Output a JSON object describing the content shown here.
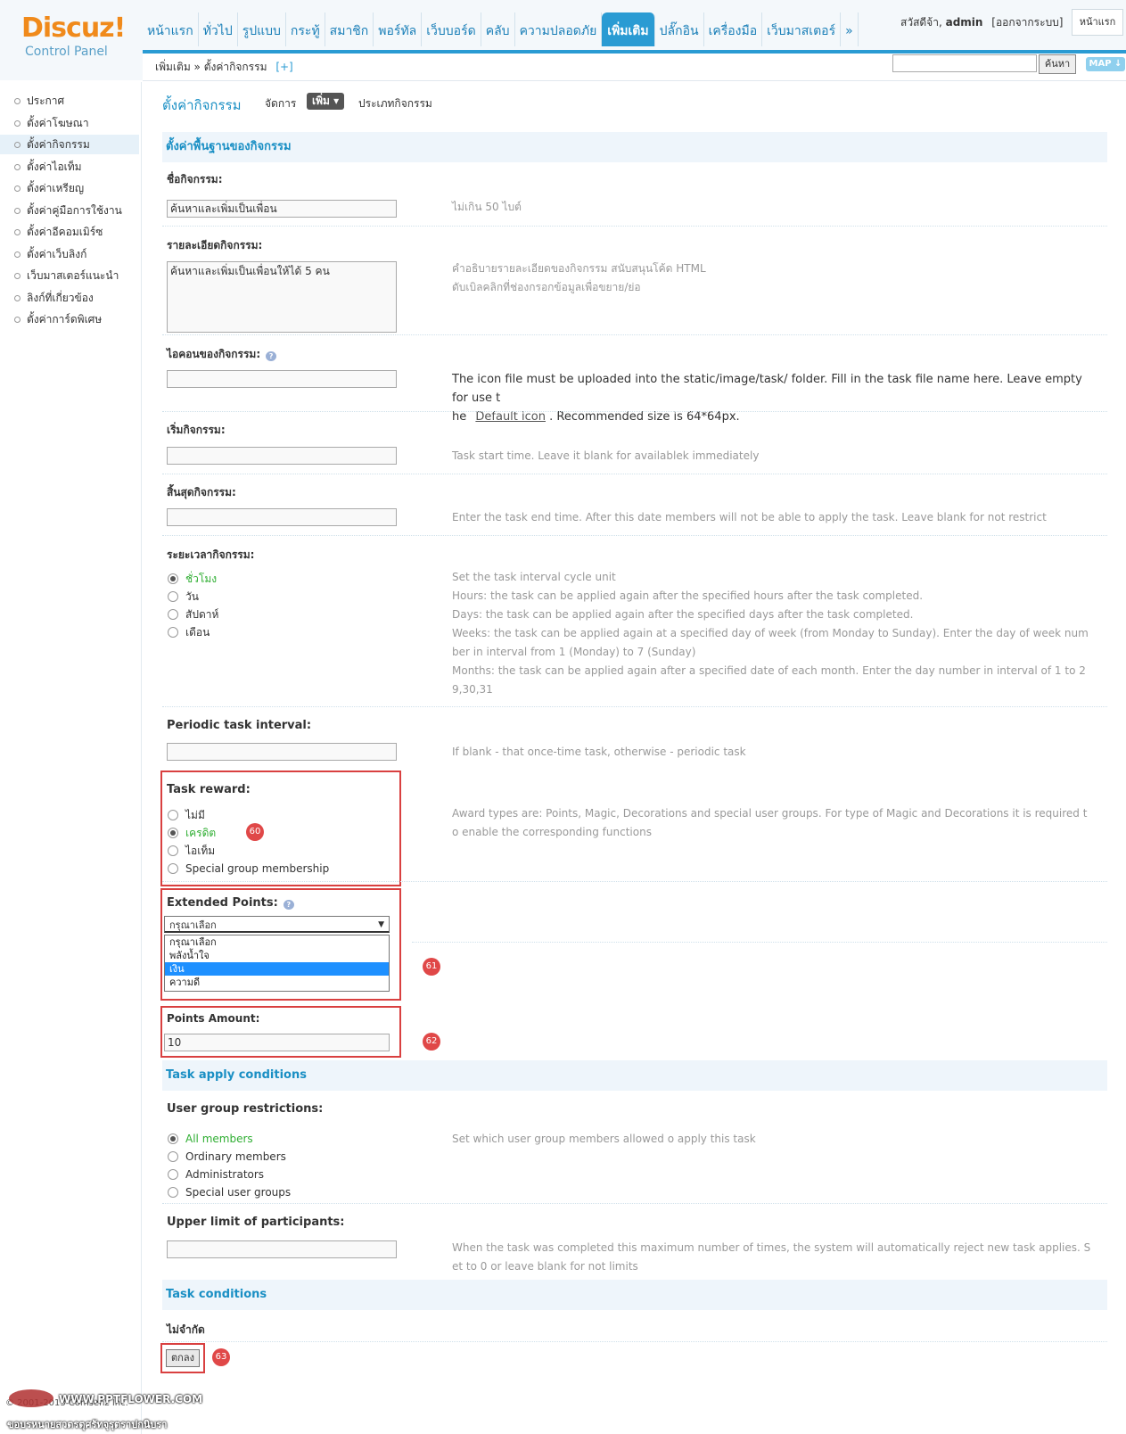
{
  "app": {
    "logo_main": "Discuz!",
    "logo_sub": "Control Panel"
  },
  "nav": [
    "หน้าแรก",
    "ทั่วไป",
    "รูปแบบ",
    "กระทู้",
    "สมาชิก",
    "พอร์ทัล",
    "เว็บบอร์ด",
    "คลับ",
    "ความปลอดภัย",
    "เพิ่มเติม",
    "ปลั๊กอิน",
    "เครื่องมือ",
    "เว็บมาสเตอร์",
    "»"
  ],
  "user": {
    "greeting": "สวัสดีจ้า,",
    "name": "admin",
    "logout": "[ออกจากระบบ]",
    "home": "หน้าแรก"
  },
  "breadcrumb": {
    "path": "เพิ่มเติม » ตั้งค่ากิจกรรม",
    "plus": "[+]"
  },
  "search": {
    "button": "ค้นหา",
    "map": "MAP ↓"
  },
  "sidebar": [
    "ประกาศ",
    "ตั้งค่าโฆษณา",
    "ตั้งค่ากิจกรรม",
    "ตั้งค่าไอเท็ม",
    "ตั้งค่าเหรียญ",
    "ตั้งค่าคู่มือการใช้งาน",
    "ตั้งค่าอีคอมเมิร์ซ",
    "ตั้งค่าเว็บลิงก์",
    "เว็บมาสเตอร์แนะนำ",
    "ลิงก์ที่เกี่ยวข้อง",
    "ตั้งค่าการ์ดพิเศษ"
  ],
  "page": {
    "title": "ตั้งค่ากิจกรรม",
    "tab_manage": "จัดการ",
    "tab_add": "เพิ่ม ▾",
    "tab_types": "ประเภทกิจกรรม"
  },
  "section_basic": "ตั้งค่าพื้นฐานของกิจกรรม",
  "fields": {
    "name": {
      "label": "ชื่อกิจกรรม:",
      "value": "ค้นหาและเพิ่มเป็นเพื่อน",
      "tip": "ไม่เกิน 50 ไบต์"
    },
    "desc": {
      "label": "รายละเอียดกิจกรรม:",
      "value": "ค้นหาและเพิ่มเป็นเพื่อนให้ได้ 5 คน",
      "tip1": "คำอธิบายรายละเอียดของกิจกรรม สนับสนุนโค้ด HTML",
      "tip2": "ดับเบิลคลิกที่ช่องกรอกข้อมูลเพื่อขยาย/ย่อ"
    },
    "icon": {
      "label": "ไอคอนของกิจกรรม:",
      "tip_a": "The icon file must be uploaded into the static/image/task/ folder. Fill in the task file name here. Leave empty for use t",
      "tip_b": "he",
      "tip_link": "Default icon",
      "tip_c": ". Recommended size is 64*64px."
    },
    "start": {
      "label": "เริ่มกิจกรรม:",
      "tip": "Task start time. Leave it blank for availablek immediately"
    },
    "end": {
      "label": "สิ้นสุดกิจกรรม:",
      "tip": "Enter the task end time. After this date members will not be able to apply the task. Leave blank for not restrict"
    },
    "period": {
      "label": "ระยะเวลากิจกรรม:",
      "options": [
        "ชั่วโมง",
        "วัน",
        "สัปดาห์",
        "เดือน"
      ],
      "tips": [
        "Set the task interval cycle unit",
        "Hours: the task can be applied again after the specified hours after the task completed.",
        "Days: the task can be applied again after the specified days after the task completed.",
        "Weeks: the task can be applied again at a specified day of week (from Monday to Sunday). Enter the day of week num",
        "ber in interval from 1 (Monday) to 7 (Sunday)",
        "Months: the task can be applied again after a specified date of each month. Enter the day number in interval of 1 to 2",
        "9,30,31"
      ]
    },
    "periodic": {
      "label": "Periodic task interval:",
      "tip": "If blank - that once-time task, otherwise - periodic task"
    },
    "reward": {
      "label": "Task reward:",
      "options": [
        "ไม่มี",
        "เครดิต",
        "ไอเท็ม",
        "Special group membership"
      ],
      "tip1": "Award types are: Points, Magic, Decorations and special user groups. For type of Magic and Decorations it is required t",
      "tip2": "o enable the corresponding functions"
    },
    "extpoints": {
      "label": "Extended Points:",
      "selected": "กรุณาเลือก",
      "options": [
        "กรุณาเลือก",
        "พลังน้ำใจ",
        "เงิน",
        "ความดี"
      ]
    },
    "amount": {
      "label": "Points Amount:",
      "value": "10"
    }
  },
  "section_apply": "Task apply conditions",
  "apply": {
    "groups": {
      "label": "User group restrictions:",
      "options": [
        "All members",
        "Ordinary members",
        "Administrators",
        "Special user groups"
      ],
      "tip": "Set which user group members allowed o apply this task"
    },
    "limit": {
      "label": "Upper limit of participants:",
      "tip1": "When the task was completed this maximum number of times, the system will automatically reject new task applies. S",
      "tip2": "et to 0 or leave blank for not limits"
    }
  },
  "section_conditions": "Task conditions",
  "conditions_value": "ไม่จำกัด",
  "submit": "ตกลง",
  "badges": [
    "60",
    "61",
    "62",
    "63"
  ],
  "footer": {
    "copyright": "© 2001-2013 Comsenz Inc.",
    "watermark_url": "WWW.PPTFLOWER.COM",
    "watermark_text": "ขอบรหนายสวตรตุศรัทจุรุตราปกนิบรา"
  },
  "colors": {
    "accent": "#2a9bd3",
    "green": "#2fae32",
    "badge": "#e04848"
  }
}
